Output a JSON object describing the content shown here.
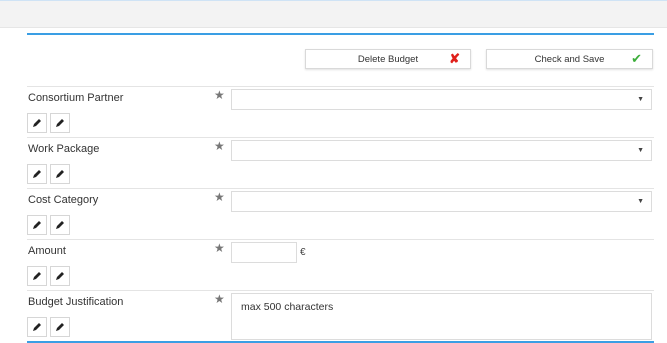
{
  "actions": {
    "delete_label": "Delete Budget",
    "check_save_label": "Check and Save"
  },
  "form": {
    "required_marker": "★",
    "currency_symbol": "€",
    "fields": [
      {
        "label": "Consortium Partner",
        "type": "select",
        "value": ""
      },
      {
        "label": "Work Package",
        "type": "select",
        "value": ""
      },
      {
        "label": "Cost Category",
        "type": "select",
        "value": ""
      },
      {
        "label": "Amount",
        "type": "number",
        "value": ""
      },
      {
        "label": "Budget Justification",
        "type": "textarea",
        "placeholder": "max 500 characters"
      }
    ]
  },
  "colors": {
    "accent": "#3a9ee4",
    "delete_icon": "#e0201b",
    "save_icon": "#3cae3a"
  },
  "icons": {
    "delete": "x-mark-icon",
    "save": "checkmark-icon",
    "edit": "pencil-icon",
    "required": "star-icon",
    "dropdown": "chevron-down-icon"
  }
}
